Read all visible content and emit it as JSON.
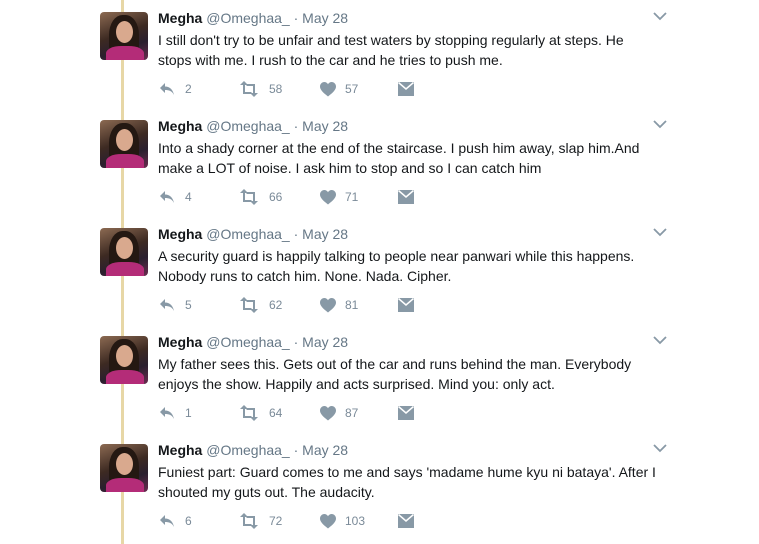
{
  "tweets": [
    {
      "name": "Megha",
      "handle": "@Omeghaa_",
      "separator": "·",
      "date": "May 28",
      "text": "I still don't try to be unfair and test waters by stopping regularly at steps. He stops with me. I rush to the car and he tries to push me.",
      "replies": "2",
      "retweets": "58",
      "likes": "57"
    },
    {
      "name": "Megha",
      "handle": "@Omeghaa_",
      "separator": "·",
      "date": "May 28",
      "text": "Into a shady corner at the end of the staircase. I push him away, slap him.And make a LOT of noise. I ask him to stop and so I can catch him",
      "replies": "4",
      "retweets": "66",
      "likes": "71"
    },
    {
      "name": "Megha",
      "handle": "@Omeghaa_",
      "separator": "·",
      "date": "May 28",
      "text": "A security guard is happily talking to people near panwari while this happens. Nobody runs to catch him. None. Nada. Cipher.",
      "replies": "5",
      "retweets": "62",
      "likes": "81"
    },
    {
      "name": "Megha",
      "handle": "@Omeghaa_",
      "separator": "·",
      "date": "May 28",
      "text": "My father sees this. Gets out of the car and runs behind the man. Everybody enjoys the show. Happily and acts surprised. Mind you: only act.",
      "replies": "1",
      "retweets": "64",
      "likes": "87"
    },
    {
      "name": "Megha",
      "handle": "@Omeghaa_",
      "separator": "·",
      "date": "May 28",
      "text": "Funiest part: Guard comes to me and says 'madame hume kyu ni bataya'. After I shouted my guts out. The audacity.",
      "replies": "6",
      "retweets": "72",
      "likes": "103"
    }
  ],
  "colors": {
    "thread_line": "#e7d7a6",
    "icon": "#8899a6",
    "meta_text": "#657786"
  },
  "icons": {
    "reply": "reply-icon",
    "retweet": "retweet-icon",
    "like": "heart-icon",
    "message": "envelope-icon",
    "more": "chevron-down-icon"
  }
}
